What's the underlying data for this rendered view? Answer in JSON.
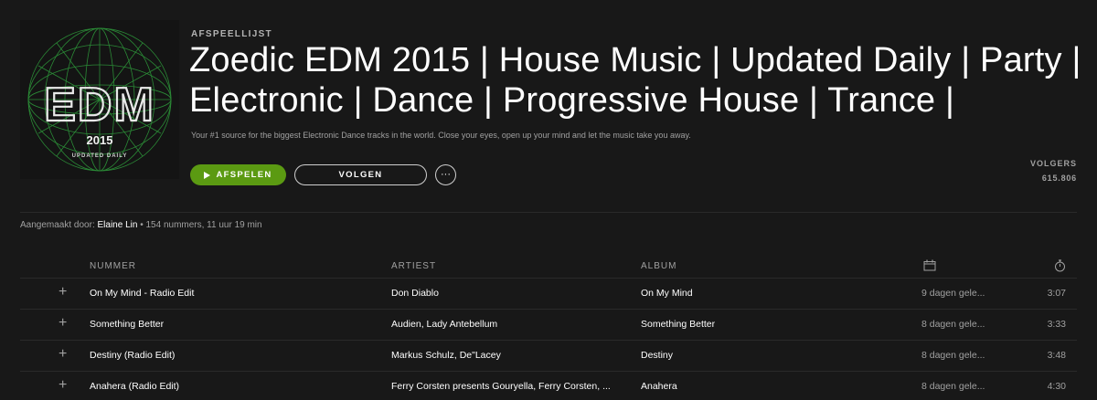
{
  "header": {
    "type_label": "AFSPEELLIJST",
    "title": "Zoedic EDM 2015 | House Music | Updated Daily | Party | Electronic | Dance | Progressive House | Trance |",
    "description": "Your #1 source for the biggest Electronic Dance tracks in the world. Close your eyes, open up your mind and let the music take you away.",
    "play_label": "AFSPELEN",
    "follow_label": "VOLGEN",
    "more_label": "···",
    "followers_label": "VOLGERS",
    "followers_count": "615.806"
  },
  "cover": {
    "title": "EDM",
    "year": "2015",
    "subtitle": "UPDATED DAILY",
    "accent_color": "#2f9e3c"
  },
  "meta": {
    "created_by_label": "Aangemaakt door:",
    "creator": "Elaine Lin",
    "summary": "• 154 nummers, 11 uur 19 min"
  },
  "table": {
    "columns": {
      "title": "NUMMER",
      "artist": "ARTIEST",
      "album": "ALBUM",
      "date_icon": "calendar-icon",
      "duration_icon": "stopwatch-icon"
    },
    "tracks": [
      {
        "title": "On My Mind - Radio Edit",
        "artist": "Don Diablo",
        "album": "On My Mind",
        "added": "9 dagen gele...",
        "duration": "3:07"
      },
      {
        "title": "Something Better",
        "artist": "Audien, Lady Antebellum",
        "album": "Something Better",
        "added": "8 dagen gele...",
        "duration": "3:33"
      },
      {
        "title": "Destiny (Radio Edit)",
        "artist": "Markus Schulz, De\"Lacey",
        "album": "Destiny",
        "added": "8 dagen gele...",
        "duration": "3:48"
      },
      {
        "title": "Anahera (Radio Edit)",
        "artist": "Ferry Corsten presents Gouryella, Ferry Corsten, ...",
        "album": "Anahera",
        "added": "8 dagen gele...",
        "duration": "4:30"
      }
    ]
  },
  "colors": {
    "background": "#181818",
    "play_button": "#5b9a12",
    "muted_text": "#a0a0a0"
  }
}
